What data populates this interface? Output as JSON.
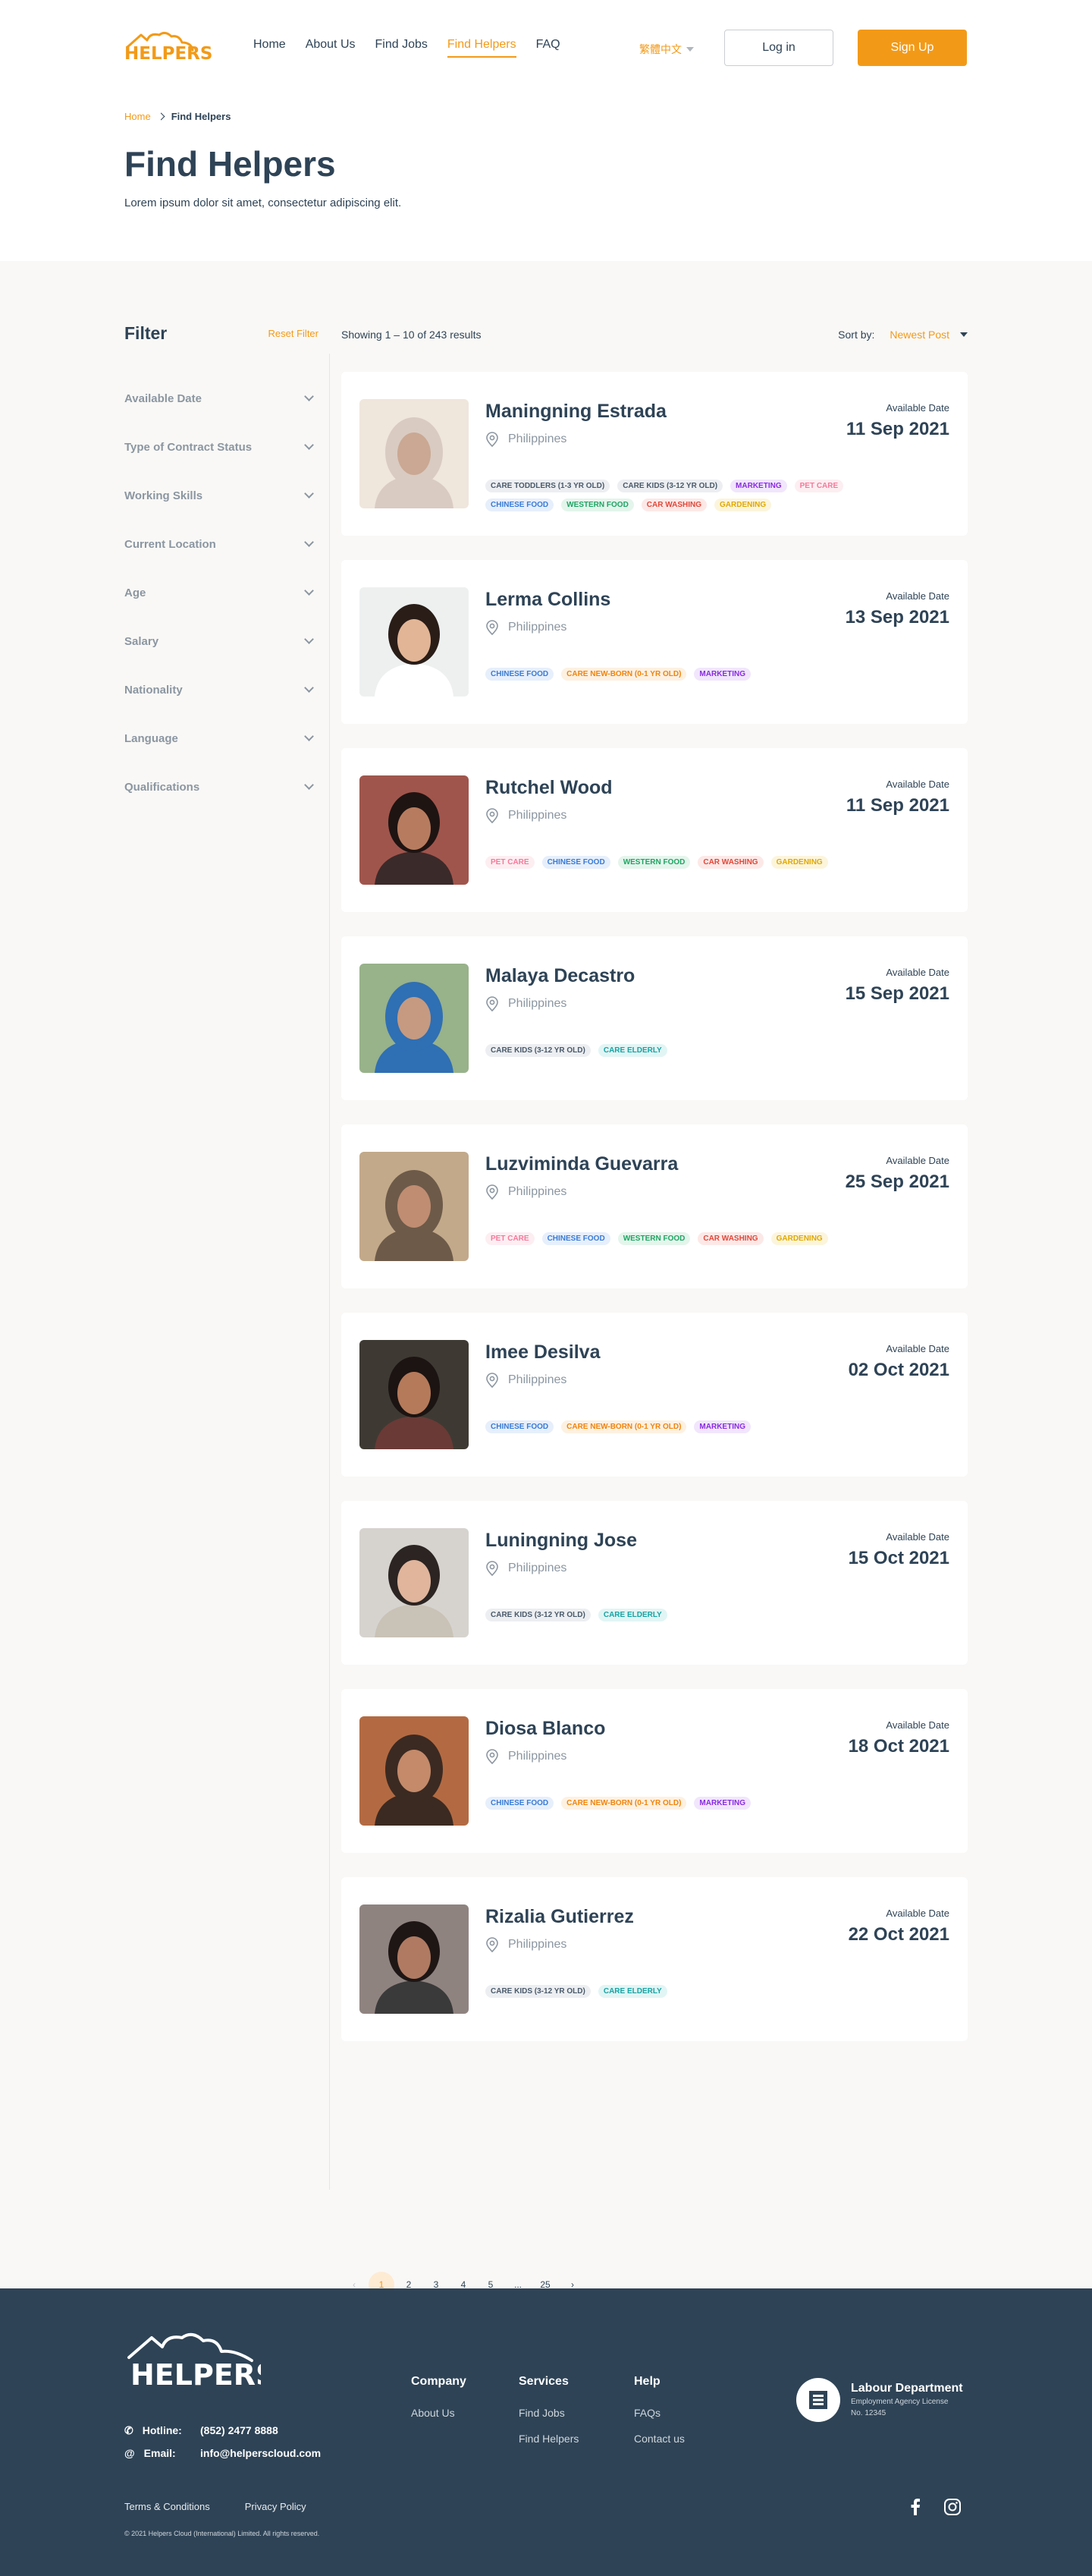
{
  "header": {
    "logo_text": "HELPERS",
    "nav": [
      "Home",
      "About Us",
      "Find Jobs",
      "Find Helpers",
      "FAQ"
    ],
    "active_nav": "Find Helpers",
    "language": "繁體中文",
    "login_label": "Log in",
    "signup_label": "Sign Up",
    "accent_color": "#f29a18"
  },
  "breadcrumb": {
    "home": "Home",
    "current": "Find Helpers"
  },
  "page": {
    "title": "Find Helpers",
    "subtitle": "Lorem ipsum dolor sit amet, consectetur adipiscing elit."
  },
  "filter": {
    "title": "Filter",
    "reset_label": "Reset Filter",
    "facets": [
      "Available Date",
      "Type of Contract Status",
      "Working Skills",
      "Current Location",
      "Age",
      "Salary",
      "Nationality",
      "Language",
      "Qualifications"
    ]
  },
  "results": {
    "showing": "Showing 1 – 10 of 243 results",
    "sort_label": "Sort by:",
    "sort_value": "Newest Post",
    "available_label": "Available Date",
    "helpers": [
      {
        "name": "Maningning Estrada",
        "location": "Philippines",
        "date": "11 Sep 2021",
        "tags": [
          "CARE TODDLERS (1-3 YR OLD)",
          "CARE KIDS (3-12 YR OLD)",
          "MARKETING",
          "PET CARE",
          "CHINESE FOOD",
          "WESTERN FOOD",
          "CAR WASHING",
          "GARDENING"
        ]
      },
      {
        "name": "Lerma Collins",
        "location": "Philippines",
        "date": "13 Sep 2021",
        "tags": [
          "CHINESE FOOD",
          "CARE NEW-BORN (0-1 YR OLD)",
          "MARKETING"
        ]
      },
      {
        "name": "Rutchel Wood",
        "location": "Philippines",
        "date": "11 Sep 2021",
        "tags": [
          "PET CARE",
          "CHINESE FOOD",
          "WESTERN FOOD",
          "CAR WASHING",
          "GARDENING"
        ]
      },
      {
        "name": "Malaya Decastro",
        "location": "Philippines",
        "date": "15 Sep 2021",
        "tags": [
          "CARE KIDS (3-12 YR OLD)",
          "CARE ELDERLY"
        ]
      },
      {
        "name": "Luzviminda Guevarra",
        "location": "Philippines",
        "date": "25 Sep 2021",
        "tags": [
          "PET CARE",
          "CHINESE FOOD",
          "WESTERN FOOD",
          "CAR WASHING",
          "GARDENING"
        ]
      },
      {
        "name": "Imee Desilva",
        "location": "Philippines",
        "date": "02 Oct 2021",
        "tags": [
          "CHINESE FOOD",
          "CARE NEW-BORN (0-1 YR OLD)",
          "MARKETING"
        ]
      },
      {
        "name": "Luningning Jose",
        "location": "Philippines",
        "date": "15 Oct 2021",
        "tags": [
          "CARE KIDS (3-12 YR OLD)",
          "CARE ELDERLY"
        ]
      },
      {
        "name": "Diosa Blanco",
        "location": "Philippines",
        "date": "18 Oct 2021",
        "tags": [
          "CHINESE FOOD",
          "CARE NEW-BORN (0-1 YR OLD)",
          "MARKETING"
        ]
      },
      {
        "name": "Rizalia Gutierrez",
        "location": "Philippines",
        "date": "22 Oct 2021",
        "tags": [
          "CARE KIDS (3-12 YR OLD)",
          "CARE ELDERLY"
        ]
      }
    ]
  },
  "tag_colors": {
    "CARE TODDLERS (1-3 YR OLD)": {
      "fg": "#4a5a6b",
      "bg": "#eceef1"
    },
    "CARE KIDS (3-12 YR OLD)": {
      "fg": "#4a5a6b",
      "bg": "#eceef1"
    },
    "MARKETING": {
      "fg": "#8a2be2",
      "bg": "#f1e6fc"
    },
    "PET CARE": {
      "fg": "#f47a9b",
      "bg": "#fdeef2"
    },
    "CHINESE FOOD": {
      "fg": "#3a7bd5",
      "bg": "#e6effb"
    },
    "WESTERN FOOD": {
      "fg": "#1fa463",
      "bg": "#e4f5ec"
    },
    "CAR WASHING": {
      "fg": "#e0483a",
      "bg": "#fce9e7"
    },
    "GARDENING": {
      "fg": "#e0a800",
      "bg": "#fcf5dc"
    },
    "CARE NEW-BORN (0-1 YR OLD)": {
      "fg": "#f0840c",
      "bg": "#fdf1e2"
    },
    "CARE ELDERLY": {
      "fg": "#17a3a3",
      "bg": "#e2f5f5"
    }
  },
  "pagination": {
    "prev": "‹",
    "pages": [
      "1",
      "2",
      "3",
      "4",
      "5",
      "...",
      "25"
    ],
    "next": "›",
    "active": "1"
  },
  "footer": {
    "logo_text": "HELPERS",
    "hotline_label": "Hotline:",
    "hotline": "(852) 2477 8888",
    "email_label": "Email:",
    "email": "info@helperscloud.com",
    "columns": [
      {
        "title": "Company",
        "links": [
          "About Us"
        ]
      },
      {
        "title": "Services",
        "links": [
          "Find Jobs",
          "Find Helpers"
        ]
      },
      {
        "title": "Help",
        "links": [
          "FAQs",
          "Contact us"
        ]
      }
    ],
    "labour": {
      "title": "Labour Department",
      "line1": "Employment Agency License",
      "line2": "No. 12345"
    },
    "terms": "Terms & Conditions",
    "privacy": "Privacy Policy",
    "copyright": "© 2021 Helpers Cloud (International) Limited. All rights reserved."
  }
}
